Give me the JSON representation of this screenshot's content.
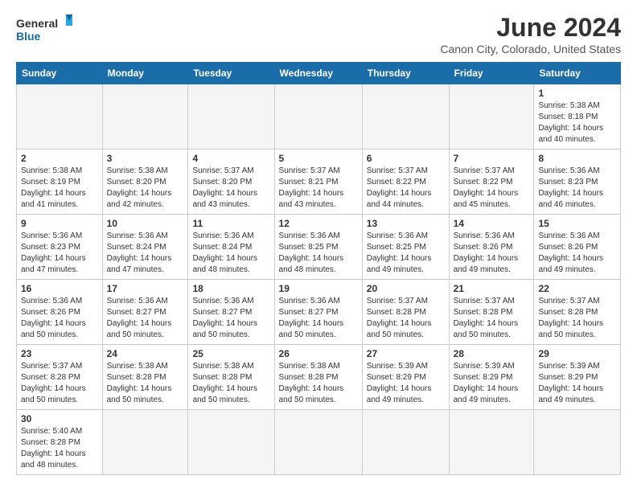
{
  "header": {
    "logo_general": "General",
    "logo_blue": "Blue",
    "month_title": "June 2024",
    "location": "Canon City, Colorado, United States"
  },
  "days_of_week": [
    "Sunday",
    "Monday",
    "Tuesday",
    "Wednesday",
    "Thursday",
    "Friday",
    "Saturday"
  ],
  "weeks": [
    [
      {
        "num": "",
        "info": ""
      },
      {
        "num": "",
        "info": ""
      },
      {
        "num": "",
        "info": ""
      },
      {
        "num": "",
        "info": ""
      },
      {
        "num": "",
        "info": ""
      },
      {
        "num": "",
        "info": ""
      },
      {
        "num": "1",
        "info": "Sunrise: 5:38 AM\nSunset: 8:18 PM\nDaylight: 14 hours and 40 minutes."
      }
    ],
    [
      {
        "num": "2",
        "info": "Sunrise: 5:38 AM\nSunset: 8:19 PM\nDaylight: 14 hours and 41 minutes."
      },
      {
        "num": "3",
        "info": "Sunrise: 5:38 AM\nSunset: 8:20 PM\nDaylight: 14 hours and 42 minutes."
      },
      {
        "num": "4",
        "info": "Sunrise: 5:37 AM\nSunset: 8:20 PM\nDaylight: 14 hours and 43 minutes."
      },
      {
        "num": "5",
        "info": "Sunrise: 5:37 AM\nSunset: 8:21 PM\nDaylight: 14 hours and 43 minutes."
      },
      {
        "num": "6",
        "info": "Sunrise: 5:37 AM\nSunset: 8:22 PM\nDaylight: 14 hours and 44 minutes."
      },
      {
        "num": "7",
        "info": "Sunrise: 5:37 AM\nSunset: 8:22 PM\nDaylight: 14 hours and 45 minutes."
      },
      {
        "num": "8",
        "info": "Sunrise: 5:36 AM\nSunset: 8:23 PM\nDaylight: 14 hours and 46 minutes."
      }
    ],
    [
      {
        "num": "9",
        "info": "Sunrise: 5:36 AM\nSunset: 8:23 PM\nDaylight: 14 hours and 47 minutes."
      },
      {
        "num": "10",
        "info": "Sunrise: 5:36 AM\nSunset: 8:24 PM\nDaylight: 14 hours and 47 minutes."
      },
      {
        "num": "11",
        "info": "Sunrise: 5:36 AM\nSunset: 8:24 PM\nDaylight: 14 hours and 48 minutes."
      },
      {
        "num": "12",
        "info": "Sunrise: 5:36 AM\nSunset: 8:25 PM\nDaylight: 14 hours and 48 minutes."
      },
      {
        "num": "13",
        "info": "Sunrise: 5:36 AM\nSunset: 8:25 PM\nDaylight: 14 hours and 49 minutes."
      },
      {
        "num": "14",
        "info": "Sunrise: 5:36 AM\nSunset: 8:26 PM\nDaylight: 14 hours and 49 minutes."
      },
      {
        "num": "15",
        "info": "Sunrise: 5:36 AM\nSunset: 8:26 PM\nDaylight: 14 hours and 49 minutes."
      }
    ],
    [
      {
        "num": "16",
        "info": "Sunrise: 5:36 AM\nSunset: 8:26 PM\nDaylight: 14 hours and 50 minutes."
      },
      {
        "num": "17",
        "info": "Sunrise: 5:36 AM\nSunset: 8:27 PM\nDaylight: 14 hours and 50 minutes."
      },
      {
        "num": "18",
        "info": "Sunrise: 5:36 AM\nSunset: 8:27 PM\nDaylight: 14 hours and 50 minutes."
      },
      {
        "num": "19",
        "info": "Sunrise: 5:36 AM\nSunset: 8:27 PM\nDaylight: 14 hours and 50 minutes."
      },
      {
        "num": "20",
        "info": "Sunrise: 5:37 AM\nSunset: 8:28 PM\nDaylight: 14 hours and 50 minutes."
      },
      {
        "num": "21",
        "info": "Sunrise: 5:37 AM\nSunset: 8:28 PM\nDaylight: 14 hours and 50 minutes."
      },
      {
        "num": "22",
        "info": "Sunrise: 5:37 AM\nSunset: 8:28 PM\nDaylight: 14 hours and 50 minutes."
      }
    ],
    [
      {
        "num": "23",
        "info": "Sunrise: 5:37 AM\nSunset: 8:28 PM\nDaylight: 14 hours and 50 minutes."
      },
      {
        "num": "24",
        "info": "Sunrise: 5:38 AM\nSunset: 8:28 PM\nDaylight: 14 hours and 50 minutes."
      },
      {
        "num": "25",
        "info": "Sunrise: 5:38 AM\nSunset: 8:28 PM\nDaylight: 14 hours and 50 minutes."
      },
      {
        "num": "26",
        "info": "Sunrise: 5:38 AM\nSunset: 8:28 PM\nDaylight: 14 hours and 50 minutes."
      },
      {
        "num": "27",
        "info": "Sunrise: 5:39 AM\nSunset: 8:29 PM\nDaylight: 14 hours and 49 minutes."
      },
      {
        "num": "28",
        "info": "Sunrise: 5:39 AM\nSunset: 8:29 PM\nDaylight: 14 hours and 49 minutes."
      },
      {
        "num": "29",
        "info": "Sunrise: 5:39 AM\nSunset: 8:29 PM\nDaylight: 14 hours and 49 minutes."
      }
    ],
    [
      {
        "num": "30",
        "info": "Sunrise: 5:40 AM\nSunset: 8:28 PM\nDaylight: 14 hours and 48 minutes."
      },
      {
        "num": "",
        "info": ""
      },
      {
        "num": "",
        "info": ""
      },
      {
        "num": "",
        "info": ""
      },
      {
        "num": "",
        "info": ""
      },
      {
        "num": "",
        "info": ""
      },
      {
        "num": "",
        "info": ""
      }
    ]
  ]
}
